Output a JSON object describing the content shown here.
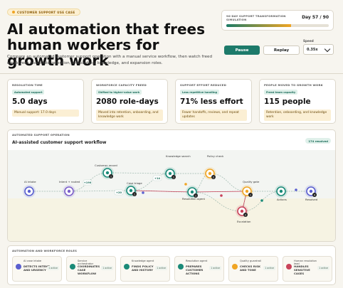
{
  "header": {
    "tag": "CUSTOMER SUPPORT USE CASE",
    "title": "AI automation that frees human workers for growth work",
    "subtitle": "Compare an automated customer support operation with a manual service workflow, then watch freed employees move into retention, onboarding, knowledge, and expansion roles."
  },
  "simulation": {
    "label": "90-DAY SUPPORT TRANSFORMATION SIMULATION",
    "day": "Day 57 / 90",
    "progress": 0.633
  },
  "controls": {
    "pause_label": "Pause",
    "replay_label": "Replay",
    "speed_label": "Speed",
    "speed_value": "0.35x"
  },
  "metrics": [
    {
      "title": "RESOLUTION TIME",
      "pill": "Automated support",
      "value": "5.0 days",
      "note": "Manual support: 17.0 days"
    },
    {
      "title": "WORKFORCE CAPACITY FREED",
      "pill": "Shifted to higher-value work",
      "value": "2080 role-days",
      "note": "Moved into retention, onboarding, and knowledge work"
    },
    {
      "title": "SUPPORT EFFORT REDUCED",
      "pill": "Less repetitive handling",
      "value": "71% less effort",
      "note": "Fewer handoffs, reviews, and repeat updates"
    },
    {
      "title": "PEOPLE MOVED TO GROWTH WORK",
      "pill": "Freed team capacity",
      "value": "115 people",
      "note": "Retention, onboarding, and knowledge work"
    }
  ],
  "flow": {
    "title": "AUTOMATED SUPPORT OPERATION",
    "heading": "AI-assisted customer support workflow",
    "badge": "174 resolved",
    "nodes": [
      {
        "label": "AI intake",
        "color": "#5a5fcf",
        "count": ""
      },
      {
        "label": "Intent + routed",
        "color": "#7b5fc9",
        "count": ""
      },
      {
        "label": "Customer record",
        "color": "#1a8a78",
        "count": "1"
      },
      {
        "label": "Case triage",
        "color": "#1a8a78",
        "count": "1"
      },
      {
        "label": "Knowledge search",
        "color": "#1a8a78",
        "count": "1"
      },
      {
        "label": "Resolution agent",
        "color": "#1a8a78",
        "count": "1"
      },
      {
        "label": "Policy check",
        "color": "#f0a524",
        "count": "2"
      },
      {
        "label": "Quality gate",
        "color": "#f0a524",
        "count": "1"
      },
      {
        "label": "Escalation",
        "color": "#c9435a",
        "count": "2"
      },
      {
        "label": "Actions",
        "color": "#1a8a78",
        "count": ""
      },
      {
        "label": "Resolved",
        "color": "#5a5fcf",
        "count": "4"
      }
    ],
    "tokens": [
      "+190",
      "+20",
      "+14"
    ]
  },
  "roles": {
    "title": "AUTOMATION AND WORKFORCE ROLES",
    "items": [
      {
        "name": "AI case intake",
        "skill": "DETECTS INTENT AND URGENCY",
        "active": "1 active",
        "color": "#5a5fcf"
      },
      {
        "name": "Service orchestrator",
        "skill": "COORDINATES CASE WORKFLOW",
        "active": "1 active",
        "color": "#1a8a78"
      },
      {
        "name": "Knowledge agent",
        "skill": "FINDS POLICY AND HISTORY",
        "active": "1 active",
        "color": "#1a8a78"
      },
      {
        "name": "Resolution agent",
        "skill": "PREPARES CUSTOMER ACTIONS",
        "active": "1 active",
        "color": "#1a8a78"
      },
      {
        "name": "Quality guardrail",
        "skill": "CHECKS RISK AND TONE",
        "active": "1 active",
        "color": "#f0a524"
      },
      {
        "name": "Human resolution lead",
        "skill": "HANDLES SENSITIVE CASES",
        "active": "1 active",
        "color": "#c9435a"
      }
    ]
  }
}
